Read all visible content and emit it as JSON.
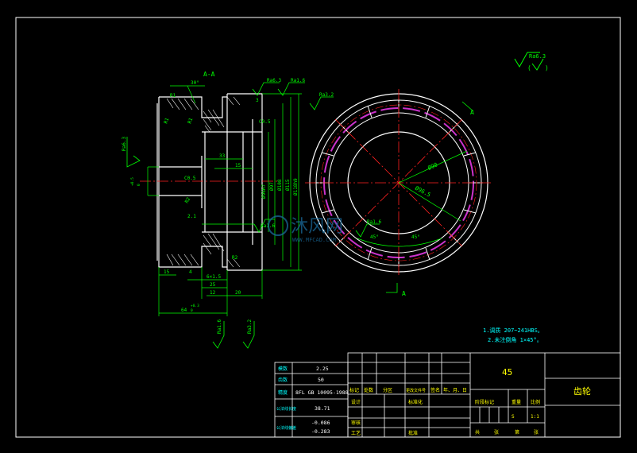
{
  "colors": {
    "background": "#000000",
    "border": "#ffffff",
    "outline": "#ffffff",
    "dimension": "#00ff00",
    "centerline": "#ff2020",
    "hatch": "#ffffff",
    "teeth": "#cc33cc",
    "annotation": "#00ffff",
    "watermark": "#1a6a9a",
    "title_text": "#ffff00"
  },
  "views": {
    "section_label": "A-A",
    "cut_label_top": "A",
    "cut_label_bottom": "A"
  },
  "surface_finish": {
    "general": "Ra6.3",
    "right_view_main": "Ra1.6",
    "marks": [
      "Ra6.3",
      "Ra1.6",
      "Ra3.2",
      "Ra6.3",
      "Ra1.6",
      "Ra1.6",
      "Ra3.2",
      "Ra1.6"
    ]
  },
  "section_dims": {
    "top_left": [
      "30°",
      "R1",
      "R1",
      "R1"
    ],
    "chamfers": [
      "C0.5",
      "C0.5"
    ],
    "diameters": [
      "Ø96H7",
      "Ø97",
      "Ø108",
      "Ø115",
      "Ø118h9"
    ],
    "horizontal": [
      "33",
      "15",
      "6×1.5",
      "25",
      "20",
      "15",
      "12",
      "64"
    ],
    "tolerances": [
      "+0.3",
      "0",
      "+0.5",
      "0"
    ],
    "small": [
      "2.1",
      "R2",
      "R2",
      "4",
      "3"
    ]
  },
  "front_dims": {
    "d1": "Ø90",
    "d2": "Ø96.5",
    "angle_left": "45°",
    "angle_right": "45°"
  },
  "notes": [
    "1.调质 207~241HBS。",
    "2.未注倒角 1×45°。"
  ],
  "param_table": {
    "rows": [
      {
        "label": "模数",
        "value": "2.25"
      },
      {
        "label": "齿数",
        "value": "50"
      },
      {
        "label": "精度",
        "value": "8FL GB 10095-1988"
      },
      {
        "label": "公法线长度",
        "value": "38.71"
      },
      {
        "label": "公法线偏差",
        "value": "-0.086\n-0.283"
      }
    ]
  },
  "title_block": {
    "material": "45",
    "part_name": "齿轮",
    "header_labels": [
      "标记",
      "处数",
      "分区",
      "更改文件号",
      "签名",
      "年、月、日"
    ],
    "left_labels": [
      "设计",
      "审核",
      "工艺"
    ],
    "standardize": "标准化",
    "approve": "批准",
    "stage_label": "阶段标记",
    "weight_label": "重量",
    "scale_label": "比例",
    "scale_value": "1:1",
    "share": "共",
    "sheet_num": "张",
    "sheet": "第",
    "sheet_of": "张"
  },
  "watermark": {
    "text": "沐风网",
    "sub": "WWW.MFCAD.COM"
  }
}
